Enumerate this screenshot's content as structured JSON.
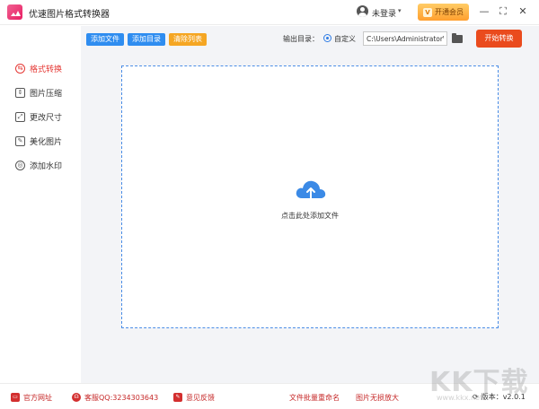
{
  "app": {
    "title": "优速图片格式转换器",
    "user_status": "未登录",
    "vip_label": "开通会员"
  },
  "window_controls": {
    "minimize": "—",
    "maximize": "⛶",
    "close": "✕"
  },
  "sidebar": {
    "items": [
      {
        "label": "格式转换",
        "icon": "convert-icon",
        "active": true
      },
      {
        "label": "图片压缩",
        "icon": "compress-icon",
        "active": false
      },
      {
        "label": "更改尺寸",
        "icon": "resize-icon",
        "active": false
      },
      {
        "label": "美化图片",
        "icon": "beautify-icon",
        "active": false
      },
      {
        "label": "添加水印",
        "icon": "watermark-icon",
        "active": false
      }
    ]
  },
  "toolbar": {
    "add_file": "添加文件",
    "add_folder": "添加目录",
    "clear_list": "清除列表",
    "output_label": "输出目录：",
    "custom_label": "自定义",
    "output_path": "C:\\Users\\Administrator\\",
    "start_label": "开始转换"
  },
  "dropzone": {
    "hint": "点击此处添加文件"
  },
  "footer": {
    "website": "官方网址",
    "support": "客服QQ:3234303643",
    "feedback": "意见反馈",
    "batch_rename": "文件批量重命名",
    "lossless_enlarge": "图片无损放大",
    "version": "版本：v2.0.1"
  },
  "watermark": {
    "text": "KK下载",
    "url": "www.kkx.net"
  },
  "colors": {
    "accent_blue": "#2f7ce5",
    "add_file_blue": "#2f8df0",
    "clear_orange": "#f5a623",
    "start_red": "#ea4b1d",
    "active_red": "#e53935",
    "footer_red": "#c62828"
  }
}
